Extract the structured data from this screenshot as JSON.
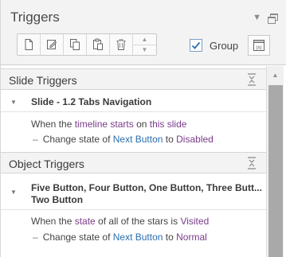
{
  "panel": {
    "title": "Triggers",
    "header_icons": [
      "chevron-down-icon",
      "restore-window-icon"
    ]
  },
  "toolbar": {
    "buttons": [
      "new-trigger-icon",
      "edit-trigger-icon",
      "copy-icon",
      "paste-icon",
      "delete-icon"
    ],
    "move_up": "▲",
    "move_down": "▼",
    "group_label": "Group",
    "group_checked": true
  },
  "sections": [
    {
      "label": "Slide Triggers",
      "triggers": [
        {
          "title": "Slide - 1.2 Tabs Navigation",
          "condition": {
            "prefix": "When the ",
            "event": "timeline starts",
            "middle": " on ",
            "object": "this slide"
          },
          "action": {
            "prefix": "Change state of ",
            "target": "Next Button",
            "middle": " to ",
            "value": "Disabled"
          }
        }
      ]
    },
    {
      "label": "Object Triggers",
      "triggers": [
        {
          "title": "Five Button, Four Button, One Button, Three Butt... Two Button",
          "condition": {
            "prefix": "When the ",
            "event": "state",
            "middle": " of all of the stars is ",
            "object": "Visited"
          },
          "action": {
            "prefix": "Change state of ",
            "target": "Next Button",
            "middle": " to ",
            "value": "Normal"
          }
        }
      ]
    }
  ],
  "colors": {
    "link": "#2a6fb0",
    "state_value": "#7a3b8a",
    "header_bg": "#f3f3f3",
    "scroll_thumb": "#a9a9a9"
  }
}
